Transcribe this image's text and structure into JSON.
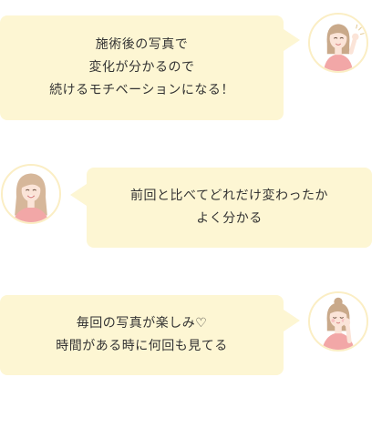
{
  "colors": {
    "bubble": "#fdf6d3",
    "avatar_ring": "#fbeec4",
    "hair": "#c9a98a",
    "skin": "#fbe4d8",
    "shirt": "#f2a7a7"
  },
  "testimonials": [
    {
      "lines": [
        "施術後の写真で",
        "変化が分かるので",
        "続けるモチベーションになる！"
      ],
      "avatar_icon": "woman-fist-pump-avatar-icon"
    },
    {
      "lines": [
        "前回と比べてどれだけ変わったか",
        "よく分かる"
      ],
      "avatar_icon": "woman-smiling-avatar-icon"
    },
    {
      "lines": [
        "毎回の写真が楽しみ♡",
        "時間がある時に何回も見てる"
      ],
      "avatar_icon": "woman-hand-on-cheek-avatar-icon"
    }
  ]
}
